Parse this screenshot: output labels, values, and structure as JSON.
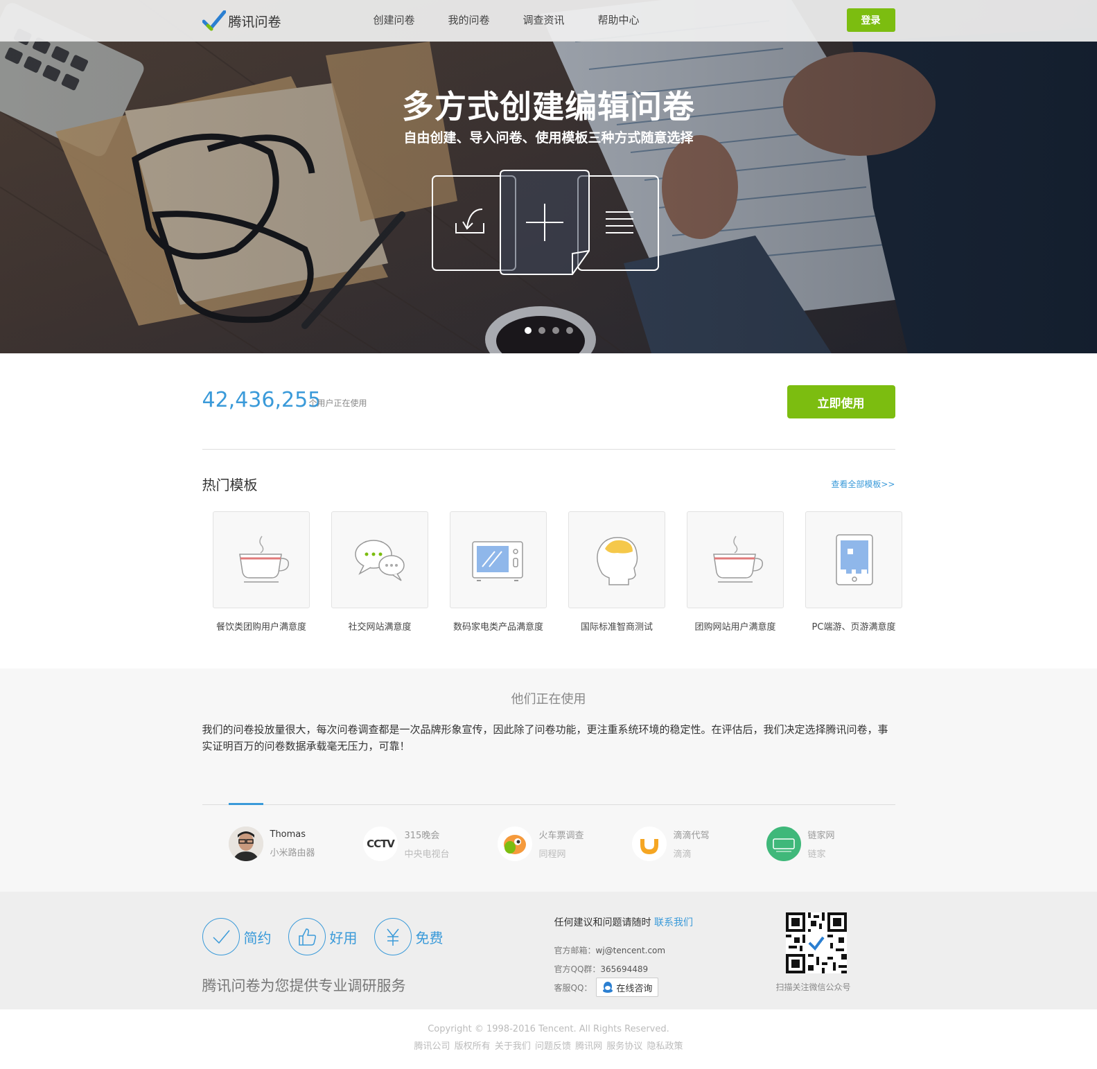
{
  "header": {
    "logo_text": "腾讯问卷",
    "nav": [
      "创建问卷",
      "我的问卷",
      "调查资讯",
      "帮助中心"
    ],
    "login_label": "登录"
  },
  "hero": {
    "title": "多方式创建编辑问卷",
    "subtitle": "自由创建、导入问卷、使用模板三种方式随意选择",
    "active_slide": 1,
    "slide_count": 4
  },
  "stats": {
    "user_count": "42,436,255",
    "user_count_label": "个用户正在使用",
    "cta_label": "立即使用"
  },
  "templates": {
    "title": "热门模板",
    "view_all": "查看全部模板>>",
    "items": [
      {
        "label": "餐饮类团购用户满意度",
        "icon": "coffee-cup-icon"
      },
      {
        "label": "社交网站满意度",
        "icon": "chat-bubbles-icon"
      },
      {
        "label": "数码家电类产品满意度",
        "icon": "microwave-icon"
      },
      {
        "label": "国际标准智商测试",
        "icon": "head-brain-icon"
      },
      {
        "label": "团购网站用户满意度",
        "icon": "coffee-cup-icon"
      },
      {
        "label": "PC端游、页游满意度",
        "icon": "tablet-game-icon"
      }
    ]
  },
  "testimonials": {
    "title": "他们正在使用",
    "quote": "我们的问卷投放量很大，每次问卷调查都是一次品牌形象宣传，因此除了问卷功能，更注重系统环境的稳定性。在评估后，我们决定选择腾讯问卷，事实证明百万的问卷数据承载毫无压力，可靠！",
    "users": [
      {
        "name": "Thomas",
        "org": "小米路由器"
      },
      {
        "name": "315晚会",
        "org": "中央电视台"
      },
      {
        "name": "火车票调查",
        "org": "同程网"
      },
      {
        "name": "滴滴代驾",
        "org": "滴滴"
      },
      {
        "name": "链家网",
        "org": "链家"
      }
    ]
  },
  "features": {
    "items": [
      "简约",
      "好用",
      "免费"
    ],
    "slogan": "腾讯问卷为您提供专业调研服务"
  },
  "contact": {
    "head": "任何建议和问题请随时",
    "head_link": "联系我们",
    "email_label": "官方邮箱：",
    "email": "wj@tencent.com",
    "qq_group_label": "官方QQ群：",
    "qq_group": "365694489",
    "service_label": "客服QQ：",
    "service_btn": "在线咨询",
    "qr_label": "扫描关注微信公众号"
  },
  "copyright": {
    "line1": "Copyright © 1998-2016 Tencent. All Rights Reserved.",
    "links": [
      "腾讯公司",
      "版权所有",
      "关于我们",
      "问题反馈",
      "腾讯网",
      "服务协议",
      "隐私政策"
    ]
  },
  "colors": {
    "accent_green": "#7cbd10",
    "accent_blue": "#3a9ad9"
  }
}
